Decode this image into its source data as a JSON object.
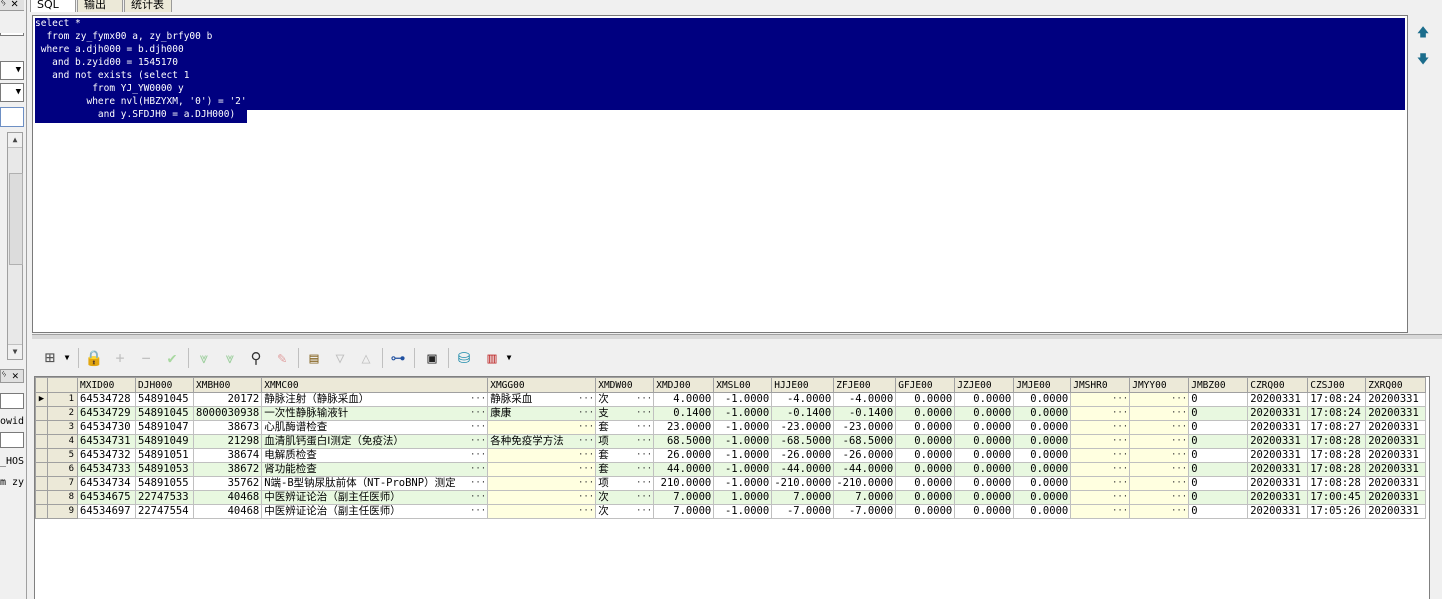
{
  "tabs": [
    "SQL",
    "输出",
    "统计表"
  ],
  "left_panel": {
    "texts": [
      "owid",
      "_HOS",
      "m zy"
    ]
  },
  "sql_lines": [
    "select *",
    "  from zy_fymx00 a, zy_brfy00 b",
    " where a.djh000 = b.djh000",
    "   and b.zyid00 = 1545170",
    "   and not exists (select 1",
    "          from YJ_YW0000 y",
    "         where nvl(HBZYXM, '0') = '2'",
    "           and y.SFDJH0 = a.DJH000)"
  ],
  "toolbar_icons": [
    "grid-menu-icon",
    "lock-icon",
    "add-record-icon",
    "delete-record-icon",
    "post-icon",
    "filter-icon",
    "clear-filter-icon",
    "find-icon",
    "clear-icon",
    "export-icon",
    "sort-desc-icon",
    "sort-asc-icon",
    "tree-icon",
    "save-icon",
    "database-icon",
    "chart-icon"
  ],
  "grid": {
    "columns": [
      "MXID00",
      "DJH000",
      "XMBH00",
      "XMMC00",
      "XMGG00",
      "XMDW00",
      "XMDJ00",
      "XMSL00",
      "HJJE00",
      "ZFJE00",
      "GFJE00",
      "JZJE00",
      "JMJE00",
      "JMSHR0",
      "JMYY00",
      "JMBZ00",
      "CZRQ00",
      "CZSJ00",
      "ZXRQ00"
    ],
    "rows": [
      [
        "64534728",
        "54891045",
        "20172",
        "静脉注射（静脉采血）",
        "静脉采血",
        "次",
        "4.0000",
        "-1.0000",
        "-4.0000",
        "-4.0000",
        "0.0000",
        "0.0000",
        "0.0000",
        "",
        "",
        "0",
        "20200331",
        "17:08:24",
        "20200331"
      ],
      [
        "64534729",
        "54891045",
        "8000030938",
        "一次性静脉输液针",
        "康康",
        "支",
        "0.1400",
        "-1.0000",
        "-0.1400",
        "-0.1400",
        "0.0000",
        "0.0000",
        "0.0000",
        "",
        "",
        "0",
        "20200331",
        "17:08:24",
        "20200331"
      ],
      [
        "64534730",
        "54891047",
        "38673",
        "心肌酶谱检查",
        "",
        "套",
        "23.0000",
        "-1.0000",
        "-23.0000",
        "-23.0000",
        "0.0000",
        "0.0000",
        "0.0000",
        "",
        "",
        "0",
        "20200331",
        "17:08:27",
        "20200331"
      ],
      [
        "64534731",
        "54891049",
        "21298",
        "血清肌钙蛋白Ⅰ测定（免疫法）",
        "各种免疫学方法",
        "项",
        "68.5000",
        "-1.0000",
        "-68.5000",
        "-68.5000",
        "0.0000",
        "0.0000",
        "0.0000",
        "",
        "",
        "0",
        "20200331",
        "17:08:28",
        "20200331"
      ],
      [
        "64534732",
        "54891051",
        "38674",
        "电解质检查",
        "",
        "套",
        "26.0000",
        "-1.0000",
        "-26.0000",
        "-26.0000",
        "0.0000",
        "0.0000",
        "0.0000",
        "",
        "",
        "0",
        "20200331",
        "17:08:28",
        "20200331"
      ],
      [
        "64534733",
        "54891053",
        "38672",
        "肾功能检查",
        "",
        "套",
        "44.0000",
        "-1.0000",
        "-44.0000",
        "-44.0000",
        "0.0000",
        "0.0000",
        "0.0000",
        "",
        "",
        "0",
        "20200331",
        "17:08:28",
        "20200331"
      ],
      [
        "64534734",
        "54891055",
        "35762",
        "N端-B型钠尿肽前体（NT-ProBNP）测定",
        "",
        "项",
        "210.0000",
        "-1.0000",
        "-210.0000",
        "-210.0000",
        "0.0000",
        "0.0000",
        "0.0000",
        "",
        "",
        "0",
        "20200331",
        "17:08:28",
        "20200331"
      ],
      [
        "64534675",
        "22747533",
        "40468",
        "中医辨证论治（副主任医师）",
        "",
        "次",
        "7.0000",
        "1.0000",
        "7.0000",
        "7.0000",
        "0.0000",
        "0.0000",
        "0.0000",
        "",
        "",
        "0",
        "20200331",
        "17:00:45",
        "20200331"
      ],
      [
        "64534697",
        "22747554",
        "40468",
        "中医辨证论治（副主任医师）",
        "",
        "次",
        "7.0000",
        "-1.0000",
        "-7.0000",
        "-7.0000",
        "0.0000",
        "0.0000",
        "0.0000",
        "",
        "",
        "0",
        "20200331",
        "17:05:26",
        "20200331"
      ]
    ]
  },
  "colors": {
    "selection": "#000080",
    "alt_row": "#e8f8e0",
    "lookup_cell": "#ffffe0"
  }
}
